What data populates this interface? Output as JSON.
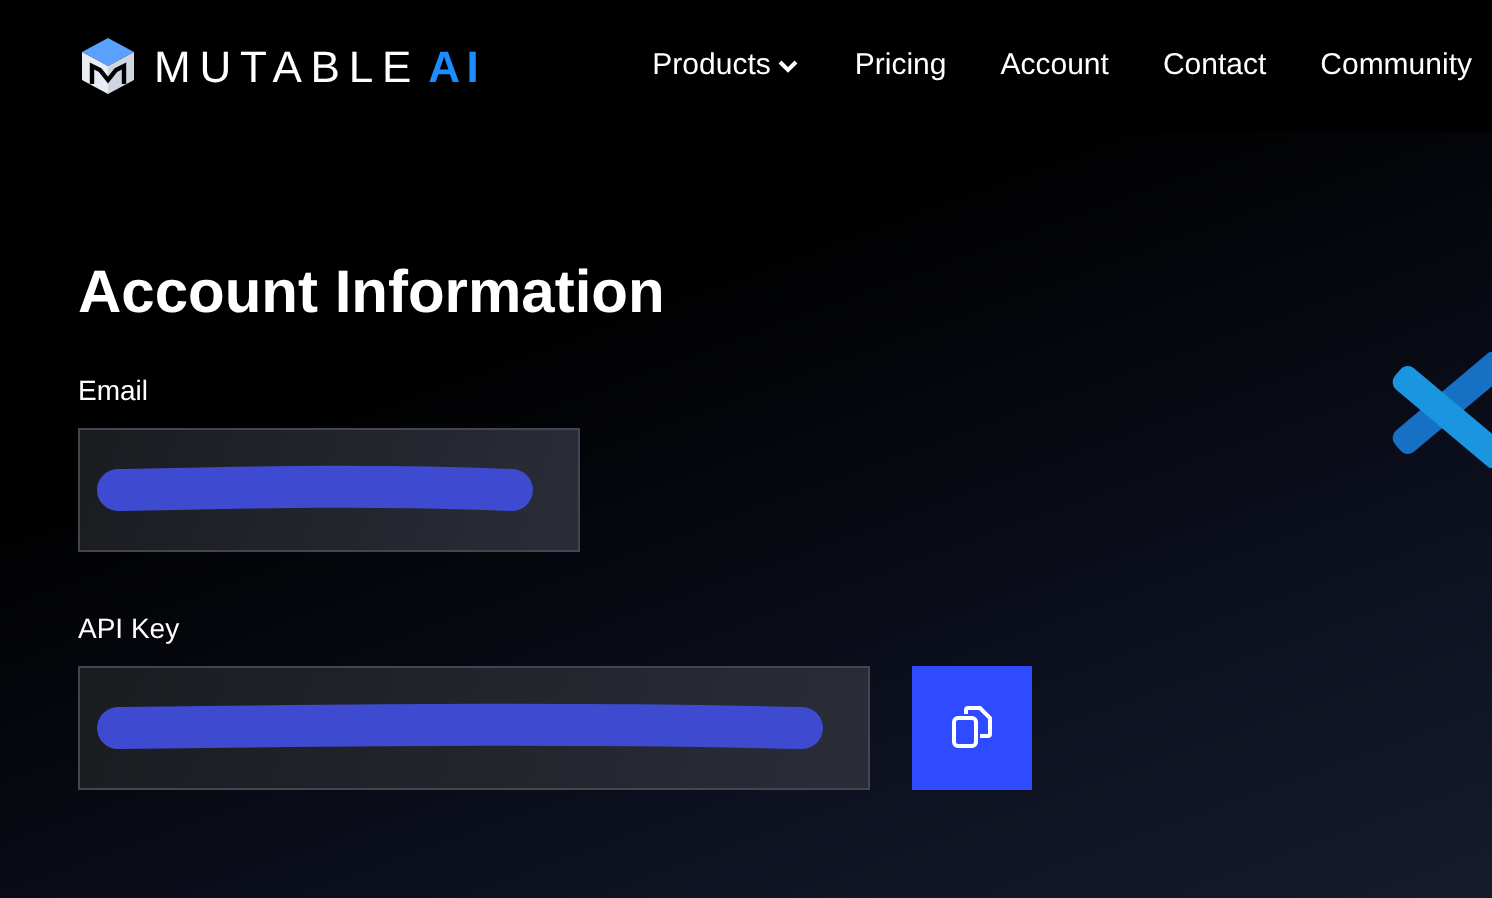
{
  "brand": {
    "name": "MUTABLE",
    "suffix": "AI"
  },
  "nav": [
    {
      "label": "Products",
      "dropdown": true
    },
    {
      "label": "Pricing",
      "dropdown": false
    },
    {
      "label": "Account",
      "dropdown": false
    },
    {
      "label": "Contact",
      "dropdown": false
    },
    {
      "label": "Community",
      "dropdown": false
    }
  ],
  "title": "Account Information",
  "fields": [
    {
      "label": "Email",
      "copy_button": false
    },
    {
      "label": "API Key",
      "copy_button": true
    }
  ]
}
